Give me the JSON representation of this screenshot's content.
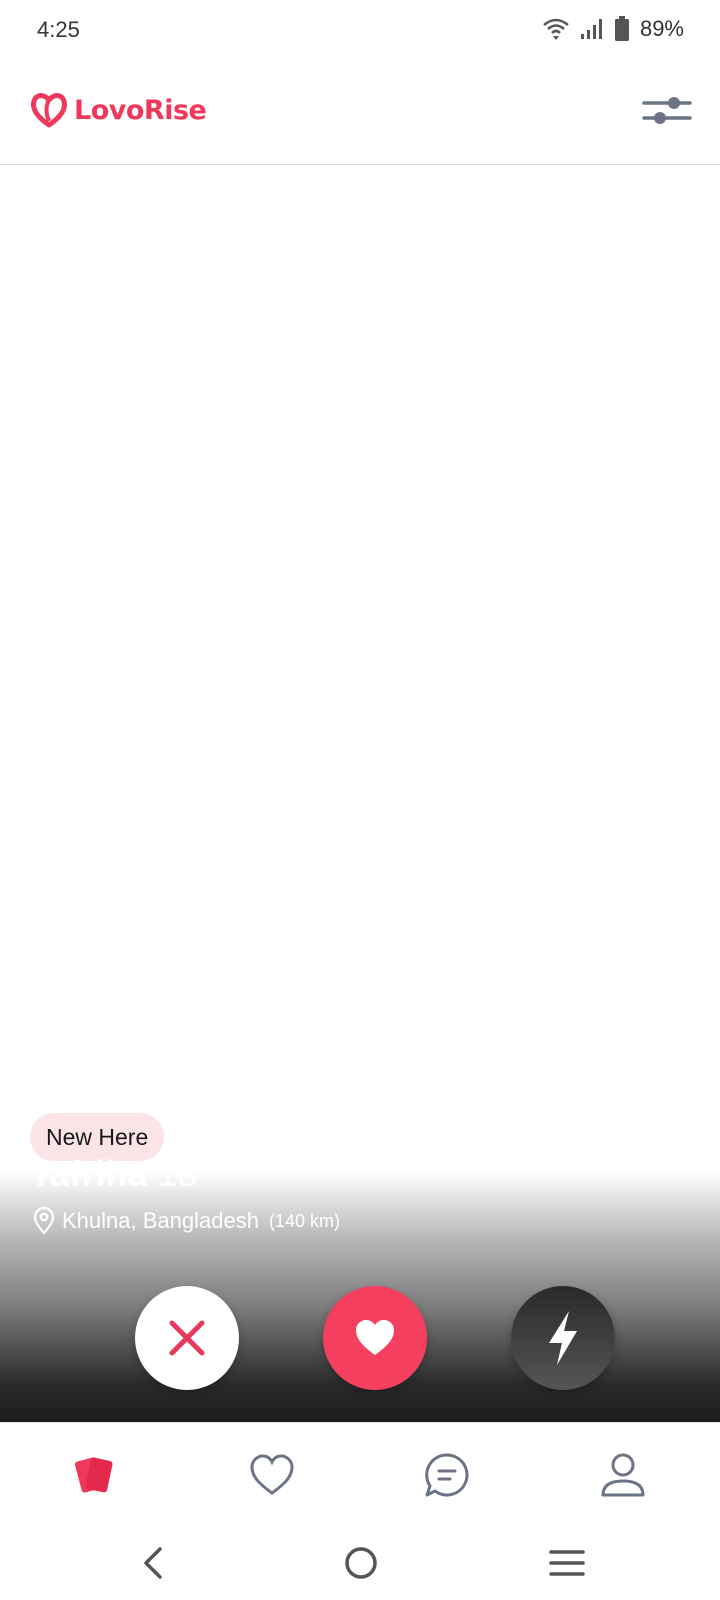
{
  "status_bar": {
    "time": "4:25",
    "battery": "89%"
  },
  "header": {
    "app_name": "LovoRise",
    "brand_color": "#f0395a",
    "filter_icon": "sliders-icon"
  },
  "card": {
    "badge": "New Here",
    "name": "Tafriha",
    "age": "18",
    "location": "Khulna, Bangladesh",
    "distance": "(140 km)"
  },
  "actions": {
    "dislike_icon": "close-icon",
    "like_icon": "heart-icon",
    "boost_icon": "lightning-icon",
    "like_color": "#f43f5e"
  },
  "bottom_nav": {
    "items": [
      {
        "icon": "cards-icon",
        "active": true
      },
      {
        "icon": "heart-outline-icon",
        "active": false
      },
      {
        "icon": "chat-icon",
        "active": false
      },
      {
        "icon": "profile-icon",
        "active": false
      }
    ],
    "active_color": "#f0395a",
    "inactive_color": "#6b7385"
  },
  "system_nav": {
    "back_icon": "back-icon",
    "home_icon": "home-icon",
    "menu_icon": "menu-icon"
  }
}
